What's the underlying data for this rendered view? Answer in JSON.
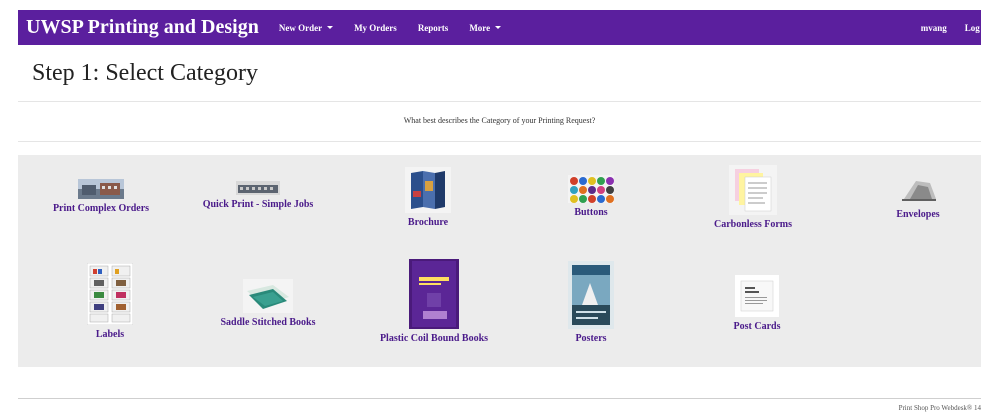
{
  "navbar": {
    "brand": "UWSP Printing and Design",
    "links": [
      {
        "label": "New Order",
        "dropdown": true
      },
      {
        "label": "My Orders",
        "dropdown": false
      },
      {
        "label": "Reports",
        "dropdown": false
      },
      {
        "label": "More",
        "dropdown": true
      }
    ],
    "user": "mvang",
    "logout": "Log O"
  },
  "page": {
    "title": "Step 1: Select Category",
    "question": "What best describes the Category of your Printing Request?"
  },
  "categories": [
    {
      "label": "Print Complex Orders",
      "icon": "building-photo-icon"
    },
    {
      "label": "Quick Print - Simple Jobs",
      "icon": "campus-photo-icon"
    },
    {
      "label": "Brochure",
      "icon": "brochure-icon"
    },
    {
      "label": "Buttons",
      "icon": "buttons-icon"
    },
    {
      "label": "Carbonless Forms",
      "icon": "carbonless-forms-icon"
    },
    {
      "label": "Envelopes",
      "icon": "envelopes-icon"
    },
    {
      "label": "Labels",
      "icon": "labels-icon"
    },
    {
      "label": "Saddle Stitched Books",
      "icon": "saddle-stitched-book-icon"
    },
    {
      "label": "Plastic Coil Bound Books",
      "icon": "coil-book-icon"
    },
    {
      "label": "Posters",
      "icon": "poster-icon"
    },
    {
      "label": "Post Cards",
      "icon": "post-card-icon"
    }
  ],
  "footer": {
    "text": "Print Shop Pro Webdesk® 14"
  },
  "colors": {
    "navbar": "#5b1f9e",
    "link": "#4a1a8a",
    "panel": "#ececec"
  }
}
